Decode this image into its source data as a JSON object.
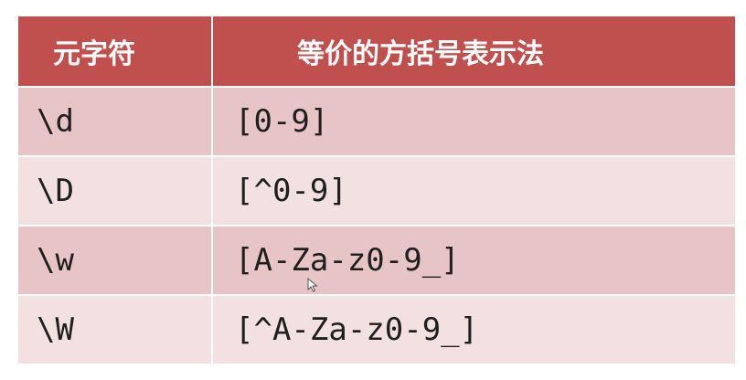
{
  "table": {
    "headers": {
      "metachar": "元字符",
      "equivalent": "等价的方括号表示法"
    },
    "rows": [
      {
        "metachar": "\\d",
        "equivalent": "[0-9]"
      },
      {
        "metachar": "\\D",
        "equivalent": "[^0-9]"
      },
      {
        "metachar": "\\w",
        "equivalent": "[A-Za-z0-9_]"
      },
      {
        "metachar": "\\W",
        "equivalent": "[^A-Za-z0-9_]"
      }
    ]
  },
  "colors": {
    "header_bg": "#c0504d",
    "row_odd_bg": "#e7c4c6",
    "row_even_bg": "#f3e1e2"
  },
  "icons": {
    "cursor": "mouse-pointer-icon"
  }
}
